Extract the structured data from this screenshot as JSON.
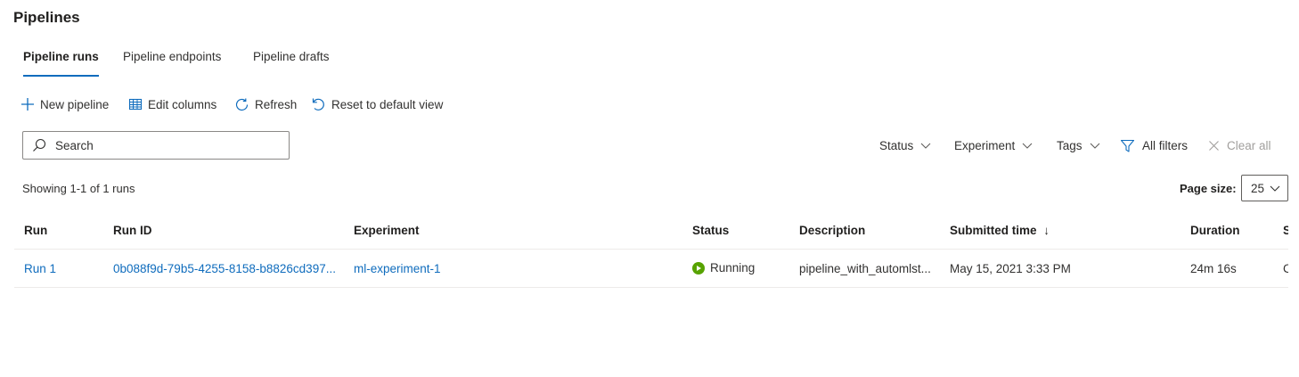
{
  "header": {
    "title": "Pipelines"
  },
  "tabs": [
    {
      "label": "Pipeline runs",
      "active": true
    },
    {
      "label": "Pipeline endpoints",
      "active": false
    },
    {
      "label": "Pipeline drafts",
      "active": false
    }
  ],
  "toolbar": {
    "new_pipeline": "New pipeline",
    "edit_columns": "Edit columns",
    "refresh": "Refresh",
    "reset_view": "Reset to default view"
  },
  "search": {
    "placeholder": "Search",
    "value": ""
  },
  "filters": {
    "status": "Status",
    "experiment": "Experiment",
    "tags": "Tags",
    "all_filters": "All filters",
    "clear_all": "Clear all"
  },
  "summary": {
    "showing": "Showing 1-1 of 1 runs"
  },
  "pagination": {
    "page_size_label": "Page size:",
    "page_size_value": "25"
  },
  "table": {
    "columns": {
      "run": "Run",
      "run_id": "Run ID",
      "experiment": "Experiment",
      "status": "Status",
      "description": "Description",
      "submitted_time": "Submitted time",
      "submitted_sort": "↓",
      "duration": "Duration",
      "truncated": "S"
    },
    "rows": [
      {
        "run": "Run 1",
        "run_id": "0b088f9d-79b5-4255-8158-b8826cd397...",
        "experiment": "ml-experiment-1",
        "status": "Running",
        "description": "pipeline_with_automlst...",
        "submitted_time": "May 15, 2021 3:33 PM",
        "duration": "24m 16s",
        "truncated": "C"
      }
    ]
  },
  "colors": {
    "accent": "#0f6cbd",
    "running": "#57a300",
    "text": "#323130",
    "disabled": "#a19f9d"
  }
}
